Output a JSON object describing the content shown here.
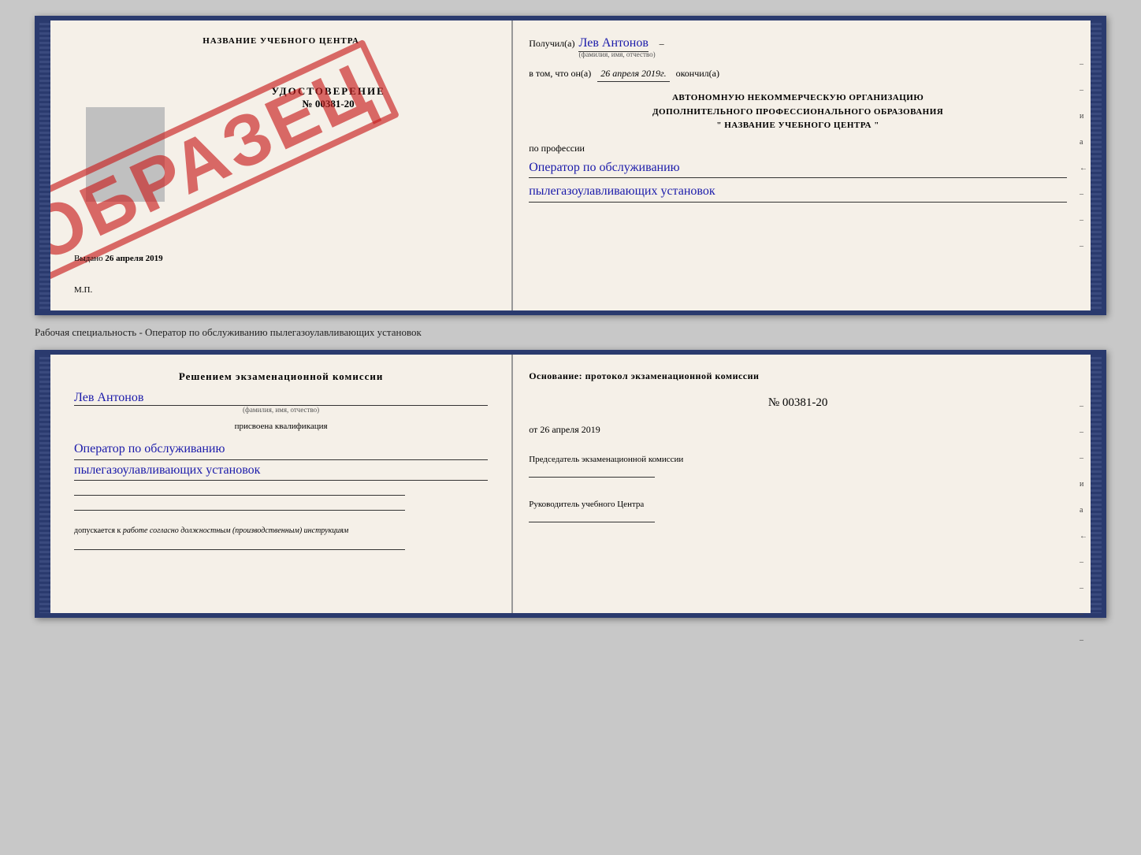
{
  "top_cert": {
    "left": {
      "title": "НАЗВАНИЕ УЧЕБНОГО ЦЕНТРА",
      "stamp": "ОБРАЗЕЦ",
      "udostoverenie": "УДОСТОВЕРЕНИЕ",
      "number": "№ 00381-20",
      "vydano_label": "Выдано",
      "vydano_date": "26 апреля 2019",
      "mp": "М.П."
    },
    "right": {
      "poluchil": "Получил(а)",
      "recipient_name": "Лев Антонов",
      "fio_label": "(фамилия, имя, отчество)",
      "v_tom_chto": "в том, что он(а)",
      "date_value": "26 апреля 2019г.",
      "okonchil": "окончил(а)",
      "org_line1": "АВТОНОМНУЮ НЕКОММЕРЧЕСКУЮ ОРГАНИЗАЦИЮ",
      "org_line2": "ДОПОЛНИТЕЛЬНОГО ПРОФЕССИОНАЛЬНОГО ОБРАЗОВАНИЯ",
      "org_name": "\"  НАЗВАНИЕ УЧЕБНОГО ЦЕНТРА  \"",
      "po_professii": "по профессии",
      "profession_line1": "Оператор по обслуживанию",
      "profession_line2": "пылегазоулавливающих установок",
      "side_marks": [
        "–",
        "–",
        "а",
        "←",
        "–",
        "–",
        "–",
        "–"
      ]
    }
  },
  "separator": "Рабочая специальность - Оператор по обслуживанию пылегазоулавливающих установок",
  "bottom_cert": {
    "left": {
      "resheniem": "Решением экзаменационной комиссии",
      "name": "Лев Антонов",
      "fio_label": "(фамилия, имя, отчество)",
      "prisvoena": "присвоена квалификация",
      "qual_line1": "Оператор по обслуживанию",
      "qual_line2": "пылегазоулавливающих установок",
      "dopuskaetsya": "допускается к",
      "dopusk_value": "работе согласно должностным (производственным) инструкциям"
    },
    "right": {
      "osnovanie": "Основание: протокол экзаменационной комиссии",
      "number": "№  00381-20",
      "ot_label": "от",
      "ot_date": "26 апреля 2019",
      "chairman_title": "Председатель экзаменационной комиссии",
      "rukov_title": "Руководитель учебного Центра",
      "side_marks": [
        "–",
        "–",
        "–",
        "и",
        "а",
        "←",
        "–",
        "–",
        "–",
        "–"
      ]
    }
  }
}
